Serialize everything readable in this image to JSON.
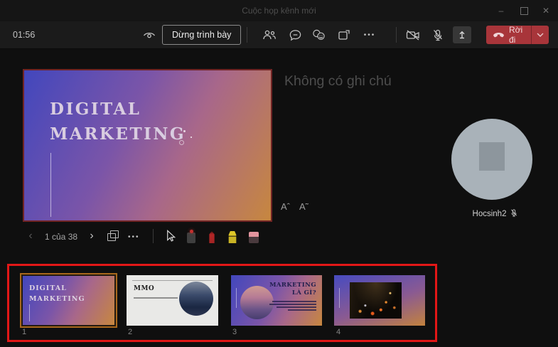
{
  "titlebar": {
    "title": "Cuộc họp kênh mới"
  },
  "toolbar": {
    "timer": "01:56",
    "stop_presenting": "Dừng trình bày",
    "leave": "Rời đi"
  },
  "presentation": {
    "slide_title_line1": "DIGITAL",
    "slide_title_line2": "MARKETING",
    "notes_empty": "Không có ghi chú",
    "font_increase": "Aˆ",
    "font_decrease": "A˜",
    "nav_position": "1 của 38"
  },
  "participant": {
    "name": "Hocsinh2"
  },
  "filmstrip": {
    "thumbnails": [
      {
        "number": "1",
        "line1": "DIGITAL",
        "line2": "MARKETING",
        "selected": true
      },
      {
        "number": "2",
        "title": "MMO"
      },
      {
        "number": "3",
        "line1": "MARKETING",
        "line2": "LÀ GÌ?"
      },
      {
        "number": "4"
      }
    ]
  },
  "colors": {
    "annotation_red": "#e21717",
    "selection_orange": "#a8681c",
    "leave_red": "#a8353a"
  }
}
